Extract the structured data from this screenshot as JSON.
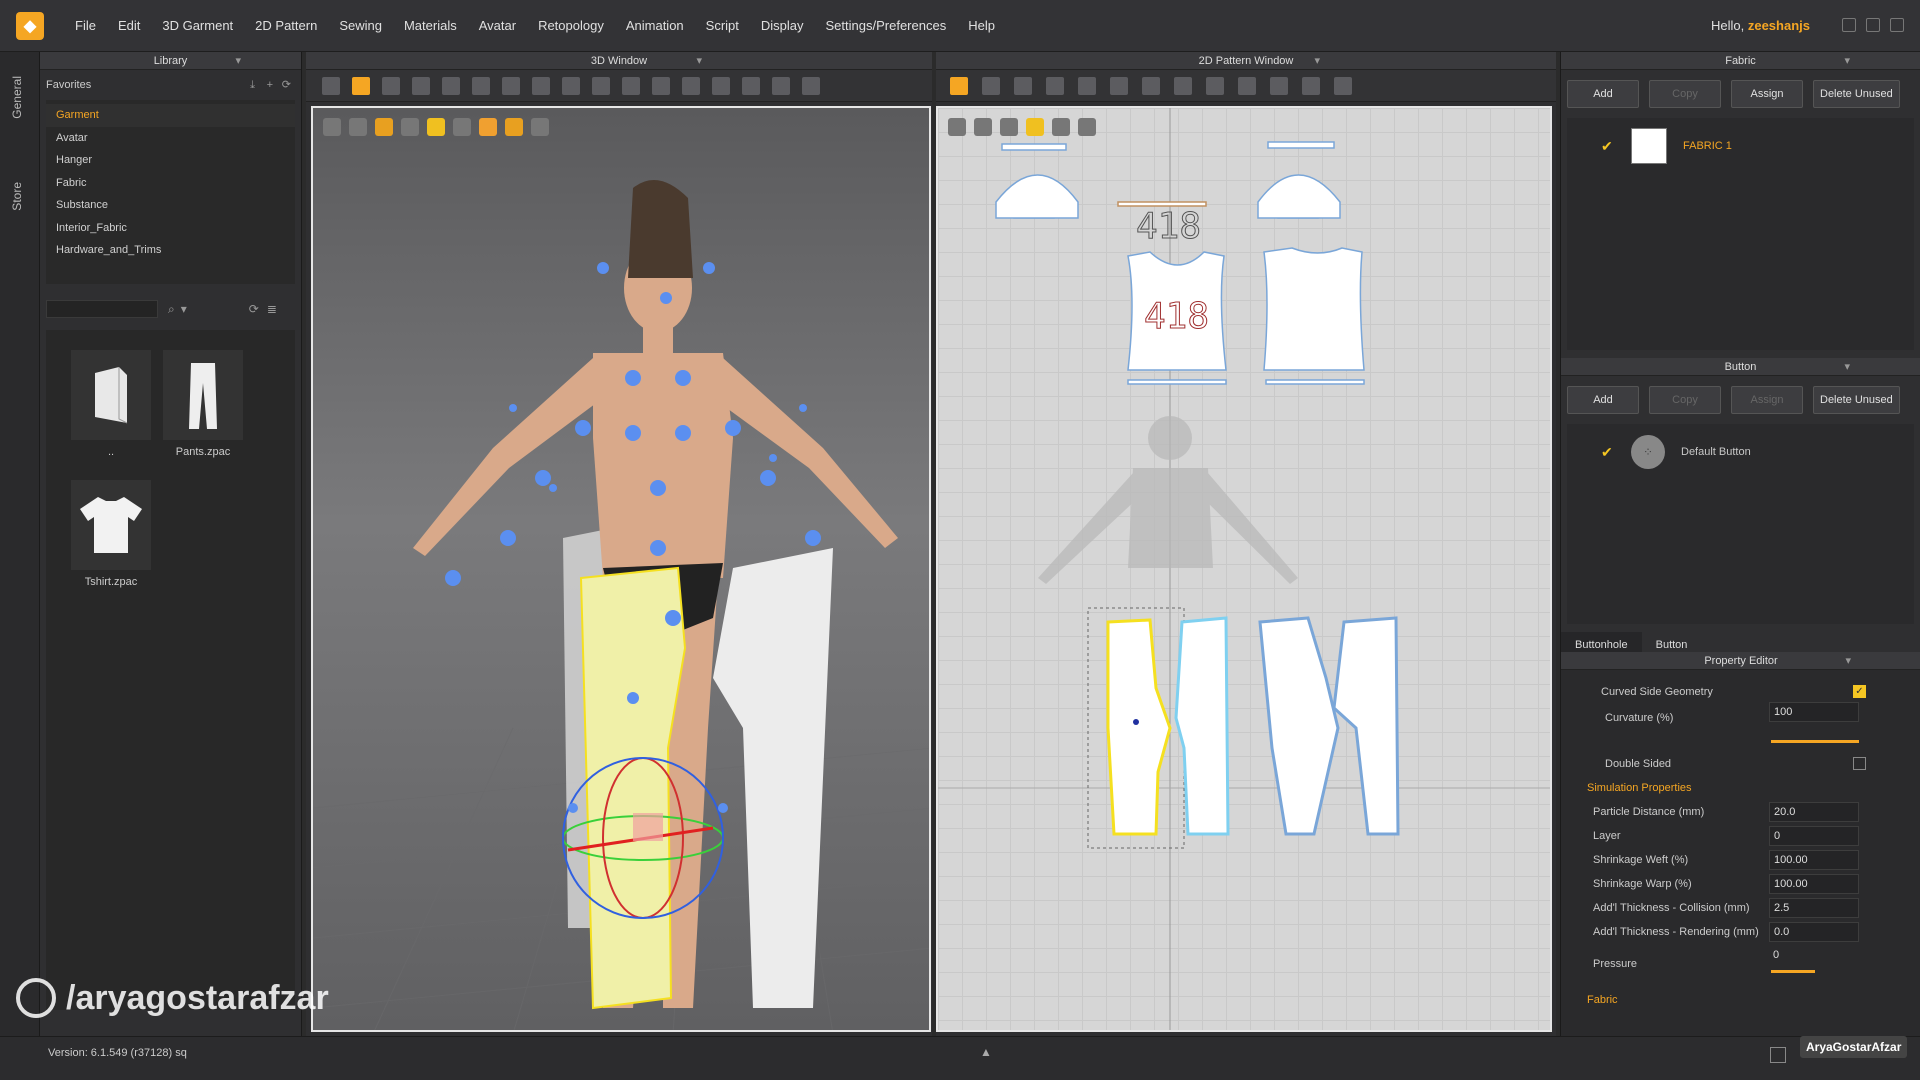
{
  "menu": {
    "items": [
      "File",
      "Edit",
      "3D Garment",
      "2D Pattern",
      "Sewing",
      "Materials",
      "Avatar",
      "Retopology",
      "Animation",
      "Script",
      "Display",
      "Settings/Preferences",
      "Help"
    ],
    "greeting_prefix": "Hello,",
    "username": "zeeshanjs"
  },
  "side_tabs": [
    "General",
    "Store"
  ],
  "library": {
    "title": "Library",
    "favorites_label": "Favorites",
    "items": [
      "Garment",
      "Avatar",
      "Hanger",
      "Fabric",
      "Substance",
      "Interior_Fabric",
      "Hardware_and_Trims"
    ],
    "active_item": "Garment",
    "files": [
      {
        "label": "..",
        "icon": "folder-up-icon"
      },
      {
        "label": "Pants.zpac",
        "icon": "pants-icon"
      },
      {
        "label": "Tshirt.zpac",
        "icon": "tshirt-icon"
      }
    ]
  },
  "window3d": {
    "title": "3D Window"
  },
  "window2d": {
    "title": "2D Pattern Window",
    "pattern_text": "418"
  },
  "fabric_panel": {
    "title": "Fabric",
    "buttons": [
      "Add",
      "Copy",
      "Assign",
      "Delete Unused"
    ],
    "items": [
      {
        "label": "FABRIC 1"
      }
    ]
  },
  "button_panel": {
    "title": "Button",
    "buttons": [
      "Add",
      "Copy",
      "Assign",
      "Delete Unused"
    ],
    "items": [
      {
        "label": "Default Button"
      }
    ]
  },
  "subtabs": [
    "Buttonhole",
    "Button"
  ],
  "property_editor": {
    "title": "Property Editor",
    "curved_side_geometry": "Curved Side Geometry",
    "curvature_label": "Curvature (%)",
    "curvature_value": "100",
    "double_sided": "Double Sided",
    "simulation_properties": "Simulation Properties",
    "rows": [
      {
        "label": "Particle Distance (mm)",
        "value": "20.0"
      },
      {
        "label": "Layer",
        "value": "0"
      },
      {
        "label": "Shrinkage Weft (%)",
        "value": "100.00"
      },
      {
        "label": "Shrinkage Warp (%)",
        "value": "100.00"
      },
      {
        "label": "Add'l Thickness - Collision (mm)",
        "value": "2.5"
      },
      {
        "label": "Add'l Thickness - Rendering (mm)",
        "value": "0.0"
      }
    ],
    "pressure_label": "Pressure",
    "pressure_value": "0",
    "fabric_section": "Fabric"
  },
  "status": {
    "version": "Version:   6.1.549 (r37128)   sq"
  },
  "watermark_left": "/aryagostarafzar",
  "watermark_right": "AryaGostarAfzar",
  "colors": {
    "accent": "#f5a623",
    "highlight_yellow": "#f5c623",
    "pattern_blue": "#5aa8e0"
  }
}
